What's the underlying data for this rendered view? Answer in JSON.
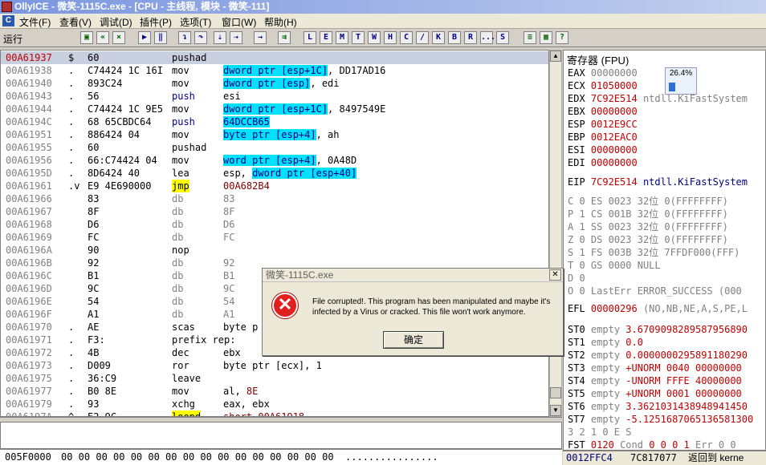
{
  "window": {
    "title": "OllyICE - 微笑-1115C.exe - [CPU - 主线程, 模块 - 微笑-111]"
  },
  "menu": [
    "文件(F)",
    "查看(V)",
    "调试(D)",
    "插件(P)",
    "选项(T)",
    "窗口(W)",
    "帮助(H)"
  ],
  "toolbar": {
    "status": "运行",
    "letters": [
      "L",
      "E",
      "M",
      "T",
      "W",
      "H",
      "C",
      "/",
      "K",
      "B",
      "R",
      "...",
      "S"
    ]
  },
  "disasm": [
    {
      "addr": "00A61937",
      "mark": "$",
      "hex": "60",
      "mn": "pushad",
      "op": "",
      "sel": true
    },
    {
      "addr": "00A61938",
      "mark": ".",
      "hex": "C74424 1C 16I",
      "mn": "mov",
      "op": "dword ptr [esp+1C]",
      "op2": ", DD17AD16"
    },
    {
      "addr": "00A61940",
      "mark": ".",
      "hex": "893C24",
      "mn": "mov",
      "op": "dword ptr [esp]",
      "op2": ", edi"
    },
    {
      "addr": "00A61943",
      "mark": ".",
      "hex": "56",
      "mn": "push",
      "op": "",
      "op2": "esi"
    },
    {
      "addr": "00A61944",
      "mark": ".",
      "hex": "C74424 1C 9E5",
      "mn": "mov",
      "op": "dword ptr [esp+1C]",
      "op2": ", 8497549E"
    },
    {
      "addr": "00A6194C",
      "mark": ".",
      "hex": "68 65CBDC64",
      "mn": "push",
      "op": "64DCCB65",
      "op2": ""
    },
    {
      "addr": "00A61951",
      "mark": ".",
      "hex": "886424 04",
      "mn": "mov",
      "op": "byte ptr [esp+4]",
      "op2": ", ah"
    },
    {
      "addr": "00A61955",
      "mark": ".",
      "hex": "60",
      "mn": "pushad",
      "op": "",
      "op2": ""
    },
    {
      "addr": "00A61956",
      "mark": ".",
      "hex": "66:C74424 04",
      "mn": "mov",
      "op": "word ptr [esp+4]",
      "op2": ", 0A48D"
    },
    {
      "addr": "00A6195D",
      "mark": ".",
      "hex": "8D6424 40",
      "mn": "lea",
      "op": "",
      "op2": "esp, ",
      "op3": "dword ptr [esp+40]"
    },
    {
      "addr": "00A61961",
      "mark": ".v",
      "hex": "E9 4E690000",
      "mn": "jmp",
      "op": "",
      "op2": "00A682B4"
    },
    {
      "addr": "00A61966",
      "mark": "",
      "hex": "83",
      "mn": "db",
      "op": "",
      "op2": "83"
    },
    {
      "addr": "00A61967",
      "mark": "",
      "hex": "8F",
      "mn": "db",
      "op": "",
      "op2": "8F"
    },
    {
      "addr": "00A61968",
      "mark": "",
      "hex": "D6",
      "mn": "db",
      "op": "",
      "op2": "D6"
    },
    {
      "addr": "00A61969",
      "mark": "",
      "hex": "FC",
      "mn": "db",
      "op": "",
      "op2": "FC"
    },
    {
      "addr": "00A6196A",
      "mark": "",
      "hex": "90",
      "mn": "nop",
      "op": "",
      "op2": ""
    },
    {
      "addr": "00A6196B",
      "mark": "",
      "hex": "92",
      "mn": "db",
      "op": "",
      "op2": "92"
    },
    {
      "addr": "00A6196C",
      "mark": "",
      "hex": "B1",
      "mn": "db",
      "op": "",
      "op2": "B1"
    },
    {
      "addr": "00A6196D",
      "mark": "",
      "hex": "9C",
      "mn": "db",
      "op": "",
      "op2": "9C"
    },
    {
      "addr": "00A6196E",
      "mark": "",
      "hex": "54",
      "mn": "db",
      "op": "",
      "op2": "54"
    },
    {
      "addr": "00A6196F",
      "mark": "",
      "hex": "A1",
      "mn": "db",
      "op": "",
      "op2": "A1"
    },
    {
      "addr": "00A61970",
      "mark": ".",
      "hex": "AE",
      "mn": "scas",
      "op": "",
      "op2": "byte p"
    },
    {
      "addr": "00A61971",
      "mark": ".",
      "hex": "F3:",
      "mn": "prefix rep:",
      "op": "",
      "op2": ""
    },
    {
      "addr": "00A61972",
      "mark": ".",
      "hex": "4B",
      "mn": "dec",
      "op": "",
      "op2": "ebx"
    },
    {
      "addr": "00A61973",
      "mark": ".",
      "hex": "D009",
      "mn": "ror",
      "op": "",
      "op2": "byte ptr [ecx], 1"
    },
    {
      "addr": "00A61975",
      "mark": ".",
      "hex": "36:C9",
      "mn": "leave",
      "op": "",
      "op2": ""
    },
    {
      "addr": "00A61977",
      "mark": ".",
      "hex": "B0 8E",
      "mn": "mov",
      "op": "",
      "op2": "al, ",
      "op3": "8E"
    },
    {
      "addr": "00A61979",
      "mark": ".",
      "hex": "93",
      "mn": "xchg",
      "op": "",
      "op2": "eax, ebx"
    },
    {
      "addr": "00A6197A",
      "mark": "^",
      "hex": "E2 9C",
      "mn": "loopd",
      "op": "",
      "op2": "short 00A61918"
    }
  ],
  "dump": {
    "addr": "005F0000",
    "bytes": "00 00 00 00 00 00 00 00 00 00 00 00 00 00 00 00  ................"
  },
  "registers": {
    "title": "寄存器 (FPU)",
    "gpr": [
      {
        "name": "EAX",
        "val": "00000000",
        "extra": ""
      },
      {
        "name": "ECX",
        "val": "01050000",
        "extra": ""
      },
      {
        "name": "EDX",
        "val": "7C92E514",
        "extra": "ntdll.KiFastSystem"
      },
      {
        "name": "EBX",
        "val": "00000000",
        "extra": ""
      },
      {
        "name": "ESP",
        "val": "0012E9CC",
        "extra": ""
      },
      {
        "name": "EBP",
        "val": "0012EAC0",
        "extra": ""
      },
      {
        "name": "ESI",
        "val": "00000000",
        "extra": ""
      },
      {
        "name": "EDI",
        "val": "00000000",
        "extra": ""
      }
    ],
    "eip": {
      "name": "EIP",
      "val": "7C92E514",
      "extra": "ntdll.KiFastSystem"
    },
    "flags": [
      {
        "f": "C 0",
        "seg": "ES 0023",
        "bits": "32位",
        "base": "0(FFFFFFFF)"
      },
      {
        "f": "P 1",
        "seg": "CS 001B",
        "bits": "32位",
        "base": "0(FFFFFFFF)"
      },
      {
        "f": "A 1",
        "seg": "SS 0023",
        "bits": "32位",
        "base": "0(FFFFFFFF)"
      },
      {
        "f": "Z 0",
        "seg": "DS 0023",
        "bits": "32位",
        "base": "0(FFFFFFFF)"
      },
      {
        "f": "S 1",
        "seg": "FS 003B",
        "bits": "32位",
        "base": "7FFDF000(FFF)"
      },
      {
        "f": "T 0",
        "seg": "GS 0000",
        "bits": "NULL",
        "base": ""
      },
      {
        "f": "D 0",
        "seg": "",
        "bits": "",
        "base": ""
      },
      {
        "f": "O 0",
        "seg": "LastErr",
        "bits": "ERROR_SUCCESS (000",
        "base": ""
      }
    ],
    "efl": {
      "name": "EFL",
      "val": "00000296",
      "extra": "(NO,NB,NE,A,S,PE,L"
    },
    "fpu": [
      {
        "name": "ST0",
        "tag": "empty",
        "val": "3.6709098289587956890"
      },
      {
        "name": "ST1",
        "tag": "empty",
        "val": "0.0"
      },
      {
        "name": "ST2",
        "tag": "empty",
        "val": "0.0000000295891180290"
      },
      {
        "name": "ST3",
        "tag": "empty",
        "val": "+UNORM 0040 00000000"
      },
      {
        "name": "ST4",
        "tag": "empty",
        "val": "-UNORM FFFE 40000000"
      },
      {
        "name": "ST5",
        "tag": "empty",
        "val": "+UNORM 0001 00000000"
      },
      {
        "name": "ST6",
        "tag": "empty",
        "val": "3.3621031438948941450"
      },
      {
        "name": "ST7",
        "tag": "empty",
        "val": "-5.1251687065136581300"
      }
    ],
    "fst_head": "3 2 1 0      E S",
    "fst": {
      "name": "FST",
      "val": "0120",
      "cond_label": "Cond",
      "cond": "0 0 0 1",
      "err": "Err 0 0"
    }
  },
  "cpu_badge": {
    "value": "26.4%",
    "level": 0.264
  },
  "stack_bar": {
    "addr": "0012FFC4",
    "val": "7C817077",
    "comment": "返回到 kerne"
  },
  "dialog": {
    "title": "微笑-1115C.exe",
    "message": "File corrupted!. This program has been manipulated and maybe it's infected by a Virus or cracked. This file won't work anymore.",
    "ok": "确定",
    "close": "✕"
  }
}
